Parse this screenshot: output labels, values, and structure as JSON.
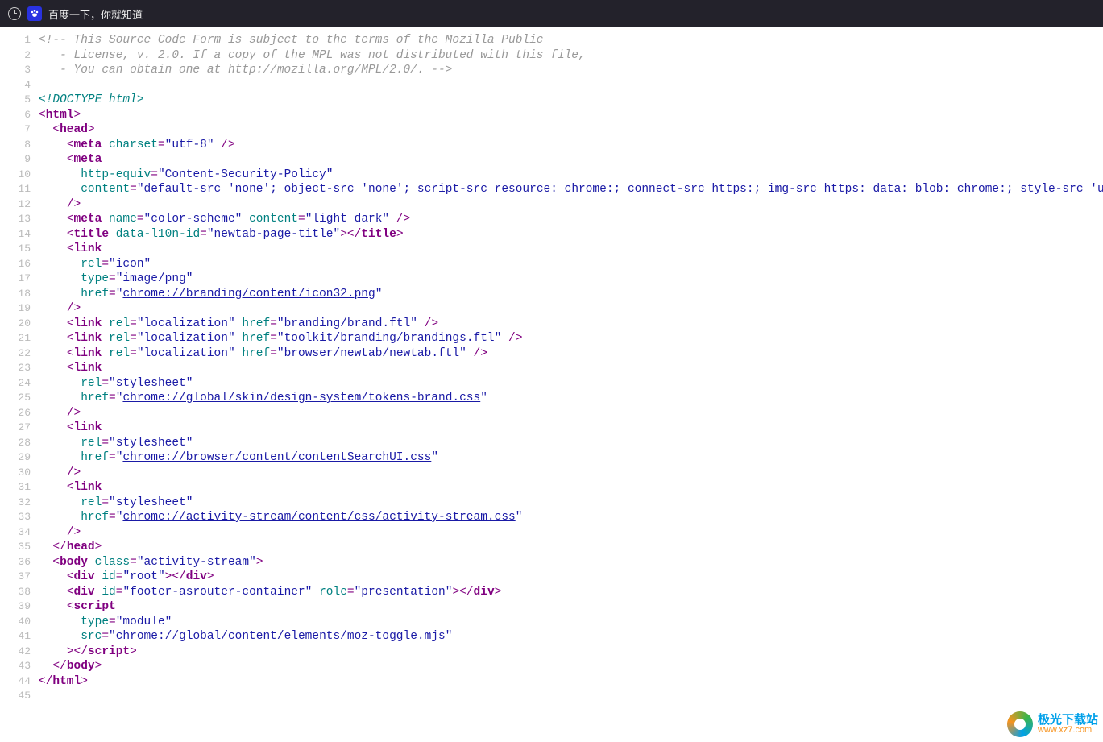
{
  "tab": {
    "title": "百度一下，你就知道"
  },
  "watermark": {
    "name": "极光下载站",
    "url": "www.xz7.com"
  },
  "lines": [
    {
      "n": 1,
      "seg": [
        {
          "c": "c",
          "t": "<!-- This Source Code Form is subject to the terms of the Mozilla Public"
        }
      ]
    },
    {
      "n": 2,
      "seg": [
        {
          "c": "c",
          "t": "   - License, v. 2.0. If a copy of the MPL was not distributed with this file,"
        }
      ]
    },
    {
      "n": 3,
      "seg": [
        {
          "c": "c",
          "t": "   - You can obtain one at http://mozilla.org/MPL/2.0/. -->"
        }
      ]
    },
    {
      "n": 4,
      "seg": []
    },
    {
      "n": 5,
      "seg": [
        {
          "c": "d",
          "t": "<!DOCTYPE html>"
        }
      ]
    },
    {
      "n": 6,
      "seg": [
        {
          "c": "p",
          "t": "<"
        },
        {
          "c": "t",
          "t": "html"
        },
        {
          "c": "p",
          "t": ">"
        }
      ]
    },
    {
      "n": 7,
      "seg": [
        {
          "t": "  "
        },
        {
          "c": "p",
          "t": "<"
        },
        {
          "c": "t",
          "t": "head"
        },
        {
          "c": "p",
          "t": ">"
        }
      ]
    },
    {
      "n": 8,
      "seg": [
        {
          "t": "    "
        },
        {
          "c": "p",
          "t": "<"
        },
        {
          "c": "t",
          "t": "meta"
        },
        {
          "t": " "
        },
        {
          "c": "a",
          "t": "charset"
        },
        {
          "c": "p",
          "t": "="
        },
        {
          "c": "s",
          "t": "\"utf-8\""
        },
        {
          "t": " "
        },
        {
          "c": "p",
          "t": "/>"
        }
      ]
    },
    {
      "n": 9,
      "seg": [
        {
          "t": "    "
        },
        {
          "c": "p",
          "t": "<"
        },
        {
          "c": "t",
          "t": "meta"
        }
      ]
    },
    {
      "n": 10,
      "seg": [
        {
          "t": "      "
        },
        {
          "c": "a",
          "t": "http-equiv"
        },
        {
          "c": "p",
          "t": "="
        },
        {
          "c": "s",
          "t": "\"Content-Security-Policy\""
        }
      ]
    },
    {
      "n": 11,
      "seg": [
        {
          "t": "      "
        },
        {
          "c": "a",
          "t": "content"
        },
        {
          "c": "p",
          "t": "="
        },
        {
          "c": "s",
          "t": "\"default-src 'none'; object-src 'none'; script-src resource: chrome:; connect-src https:; img-src https: data: blob: chrome:; style-src 'unsafe-inline'"
        }
      ]
    },
    {
      "n": 12,
      "seg": [
        {
          "t": "    "
        },
        {
          "c": "p",
          "t": "/>"
        }
      ]
    },
    {
      "n": 13,
      "seg": [
        {
          "t": "    "
        },
        {
          "c": "p",
          "t": "<"
        },
        {
          "c": "t",
          "t": "meta"
        },
        {
          "t": " "
        },
        {
          "c": "a",
          "t": "name"
        },
        {
          "c": "p",
          "t": "="
        },
        {
          "c": "s",
          "t": "\"color-scheme\""
        },
        {
          "t": " "
        },
        {
          "c": "a",
          "t": "content"
        },
        {
          "c": "p",
          "t": "="
        },
        {
          "c": "s",
          "t": "\"light dark\""
        },
        {
          "t": " "
        },
        {
          "c": "p",
          "t": "/>"
        }
      ]
    },
    {
      "n": 14,
      "seg": [
        {
          "t": "    "
        },
        {
          "c": "p",
          "t": "<"
        },
        {
          "c": "t",
          "t": "title"
        },
        {
          "t": " "
        },
        {
          "c": "a",
          "t": "data-l10n-id"
        },
        {
          "c": "p",
          "t": "="
        },
        {
          "c": "s",
          "t": "\"newtab-page-title\""
        },
        {
          "c": "p",
          "t": "></"
        },
        {
          "c": "t",
          "t": "title"
        },
        {
          "c": "p",
          "t": ">"
        }
      ]
    },
    {
      "n": 15,
      "seg": [
        {
          "t": "    "
        },
        {
          "c": "p",
          "t": "<"
        },
        {
          "c": "t",
          "t": "link"
        }
      ]
    },
    {
      "n": 16,
      "seg": [
        {
          "t": "      "
        },
        {
          "c": "a",
          "t": "rel"
        },
        {
          "c": "p",
          "t": "="
        },
        {
          "c": "s",
          "t": "\"icon\""
        }
      ]
    },
    {
      "n": 17,
      "seg": [
        {
          "t": "      "
        },
        {
          "c": "a",
          "t": "type"
        },
        {
          "c": "p",
          "t": "="
        },
        {
          "c": "s",
          "t": "\"image/png\""
        }
      ]
    },
    {
      "n": 18,
      "seg": [
        {
          "t": "      "
        },
        {
          "c": "a",
          "t": "href"
        },
        {
          "c": "p",
          "t": "="
        },
        {
          "c": "s",
          "t": "\""
        },
        {
          "c": "u",
          "t": "chrome://branding/content/icon32.png"
        },
        {
          "c": "s",
          "t": "\""
        }
      ]
    },
    {
      "n": 19,
      "seg": [
        {
          "t": "    "
        },
        {
          "c": "p",
          "t": "/>"
        }
      ]
    },
    {
      "n": 20,
      "seg": [
        {
          "t": "    "
        },
        {
          "c": "p",
          "t": "<"
        },
        {
          "c": "t",
          "t": "link"
        },
        {
          "t": " "
        },
        {
          "c": "a",
          "t": "rel"
        },
        {
          "c": "p",
          "t": "="
        },
        {
          "c": "s",
          "t": "\"localization\""
        },
        {
          "t": " "
        },
        {
          "c": "a",
          "t": "href"
        },
        {
          "c": "p",
          "t": "="
        },
        {
          "c": "s",
          "t": "\"branding/brand.ftl\""
        },
        {
          "t": " "
        },
        {
          "c": "p",
          "t": "/>"
        }
      ]
    },
    {
      "n": 21,
      "seg": [
        {
          "t": "    "
        },
        {
          "c": "p",
          "t": "<"
        },
        {
          "c": "t",
          "t": "link"
        },
        {
          "t": " "
        },
        {
          "c": "a",
          "t": "rel"
        },
        {
          "c": "p",
          "t": "="
        },
        {
          "c": "s",
          "t": "\"localization\""
        },
        {
          "t": " "
        },
        {
          "c": "a",
          "t": "href"
        },
        {
          "c": "p",
          "t": "="
        },
        {
          "c": "s",
          "t": "\"toolkit/branding/brandings.ftl\""
        },
        {
          "t": " "
        },
        {
          "c": "p",
          "t": "/>"
        }
      ]
    },
    {
      "n": 22,
      "seg": [
        {
          "t": "    "
        },
        {
          "c": "p",
          "t": "<"
        },
        {
          "c": "t",
          "t": "link"
        },
        {
          "t": " "
        },
        {
          "c": "a",
          "t": "rel"
        },
        {
          "c": "p",
          "t": "="
        },
        {
          "c": "s",
          "t": "\"localization\""
        },
        {
          "t": " "
        },
        {
          "c": "a",
          "t": "href"
        },
        {
          "c": "p",
          "t": "="
        },
        {
          "c": "s",
          "t": "\"browser/newtab/newtab.ftl\""
        },
        {
          "t": " "
        },
        {
          "c": "p",
          "t": "/>"
        }
      ]
    },
    {
      "n": 23,
      "seg": [
        {
          "t": "    "
        },
        {
          "c": "p",
          "t": "<"
        },
        {
          "c": "t",
          "t": "link"
        }
      ]
    },
    {
      "n": 24,
      "seg": [
        {
          "t": "      "
        },
        {
          "c": "a",
          "t": "rel"
        },
        {
          "c": "p",
          "t": "="
        },
        {
          "c": "s",
          "t": "\"stylesheet\""
        }
      ]
    },
    {
      "n": 25,
      "seg": [
        {
          "t": "      "
        },
        {
          "c": "a",
          "t": "href"
        },
        {
          "c": "p",
          "t": "="
        },
        {
          "c": "s",
          "t": "\""
        },
        {
          "c": "u",
          "t": "chrome://global/skin/design-system/tokens-brand.css"
        },
        {
          "c": "s",
          "t": "\""
        }
      ]
    },
    {
      "n": 26,
      "seg": [
        {
          "t": "    "
        },
        {
          "c": "p",
          "t": "/>"
        }
      ]
    },
    {
      "n": 27,
      "seg": [
        {
          "t": "    "
        },
        {
          "c": "p",
          "t": "<"
        },
        {
          "c": "t",
          "t": "link"
        }
      ]
    },
    {
      "n": 28,
      "seg": [
        {
          "t": "      "
        },
        {
          "c": "a",
          "t": "rel"
        },
        {
          "c": "p",
          "t": "="
        },
        {
          "c": "s",
          "t": "\"stylesheet\""
        }
      ]
    },
    {
      "n": 29,
      "seg": [
        {
          "t": "      "
        },
        {
          "c": "a",
          "t": "href"
        },
        {
          "c": "p",
          "t": "="
        },
        {
          "c": "s",
          "t": "\""
        },
        {
          "c": "u",
          "t": "chrome://browser/content/contentSearchUI.css"
        },
        {
          "c": "s",
          "t": "\""
        }
      ]
    },
    {
      "n": 30,
      "seg": [
        {
          "t": "    "
        },
        {
          "c": "p",
          "t": "/>"
        }
      ]
    },
    {
      "n": 31,
      "seg": [
        {
          "t": "    "
        },
        {
          "c": "p",
          "t": "<"
        },
        {
          "c": "t",
          "t": "link"
        }
      ]
    },
    {
      "n": 32,
      "seg": [
        {
          "t": "      "
        },
        {
          "c": "a",
          "t": "rel"
        },
        {
          "c": "p",
          "t": "="
        },
        {
          "c": "s",
          "t": "\"stylesheet\""
        }
      ]
    },
    {
      "n": 33,
      "seg": [
        {
          "t": "      "
        },
        {
          "c": "a",
          "t": "href"
        },
        {
          "c": "p",
          "t": "="
        },
        {
          "c": "s",
          "t": "\""
        },
        {
          "c": "u",
          "t": "chrome://activity-stream/content/css/activity-stream.css"
        },
        {
          "c": "s",
          "t": "\""
        }
      ]
    },
    {
      "n": 34,
      "seg": [
        {
          "t": "    "
        },
        {
          "c": "p",
          "t": "/>"
        }
      ]
    },
    {
      "n": 35,
      "seg": [
        {
          "t": "  "
        },
        {
          "c": "p",
          "t": "</"
        },
        {
          "c": "t",
          "t": "head"
        },
        {
          "c": "p",
          "t": ">"
        }
      ]
    },
    {
      "n": 36,
      "seg": [
        {
          "t": "  "
        },
        {
          "c": "p",
          "t": "<"
        },
        {
          "c": "t",
          "t": "body"
        },
        {
          "t": " "
        },
        {
          "c": "a",
          "t": "class"
        },
        {
          "c": "p",
          "t": "="
        },
        {
          "c": "s",
          "t": "\"activity-stream\""
        },
        {
          "c": "p",
          "t": ">"
        }
      ]
    },
    {
      "n": 37,
      "seg": [
        {
          "t": "    "
        },
        {
          "c": "p",
          "t": "<"
        },
        {
          "c": "t",
          "t": "div"
        },
        {
          "t": " "
        },
        {
          "c": "a",
          "t": "id"
        },
        {
          "c": "p",
          "t": "="
        },
        {
          "c": "s",
          "t": "\"root\""
        },
        {
          "c": "p",
          "t": "></"
        },
        {
          "c": "t",
          "t": "div"
        },
        {
          "c": "p",
          "t": ">"
        }
      ]
    },
    {
      "n": 38,
      "seg": [
        {
          "t": "    "
        },
        {
          "c": "p",
          "t": "<"
        },
        {
          "c": "t",
          "t": "div"
        },
        {
          "t": " "
        },
        {
          "c": "a",
          "t": "id"
        },
        {
          "c": "p",
          "t": "="
        },
        {
          "c": "s",
          "t": "\"footer-asrouter-container\""
        },
        {
          "t": " "
        },
        {
          "c": "a",
          "t": "role"
        },
        {
          "c": "p",
          "t": "="
        },
        {
          "c": "s",
          "t": "\"presentation\""
        },
        {
          "c": "p",
          "t": "></"
        },
        {
          "c": "t",
          "t": "div"
        },
        {
          "c": "p",
          "t": ">"
        }
      ]
    },
    {
      "n": 39,
      "seg": [
        {
          "t": "    "
        },
        {
          "c": "p",
          "t": "<"
        },
        {
          "c": "t",
          "t": "script"
        }
      ]
    },
    {
      "n": 40,
      "seg": [
        {
          "t": "      "
        },
        {
          "c": "a",
          "t": "type"
        },
        {
          "c": "p",
          "t": "="
        },
        {
          "c": "s",
          "t": "\"module\""
        }
      ]
    },
    {
      "n": 41,
      "seg": [
        {
          "t": "      "
        },
        {
          "c": "a",
          "t": "src"
        },
        {
          "c": "p",
          "t": "="
        },
        {
          "c": "s",
          "t": "\""
        },
        {
          "c": "u",
          "t": "chrome://global/content/elements/moz-toggle.mjs"
        },
        {
          "c": "s",
          "t": "\""
        }
      ]
    },
    {
      "n": 42,
      "seg": [
        {
          "t": "    "
        },
        {
          "c": "p",
          "t": "></"
        },
        {
          "c": "t",
          "t": "script"
        },
        {
          "c": "p",
          "t": ">"
        }
      ]
    },
    {
      "n": 43,
      "seg": [
        {
          "t": "  "
        },
        {
          "c": "p",
          "t": "</"
        },
        {
          "c": "t",
          "t": "body"
        },
        {
          "c": "p",
          "t": ">"
        }
      ]
    },
    {
      "n": 44,
      "seg": [
        {
          "c": "p",
          "t": "</"
        },
        {
          "c": "t",
          "t": "html"
        },
        {
          "c": "p",
          "t": ">"
        }
      ]
    },
    {
      "n": 45,
      "seg": []
    }
  ]
}
